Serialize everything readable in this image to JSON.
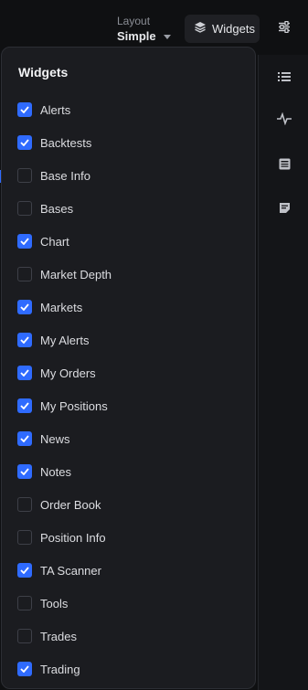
{
  "header": {
    "layout_label": "Layout",
    "layout_value": "Simple",
    "widgets_button_label": "Widgets"
  },
  "panel": {
    "title": "Widgets",
    "items": [
      {
        "label": "Alerts",
        "checked": true
      },
      {
        "label": "Backtests",
        "checked": true
      },
      {
        "label": "Base Info",
        "checked": false
      },
      {
        "label": "Bases",
        "checked": false
      },
      {
        "label": "Chart",
        "checked": true
      },
      {
        "label": "Market Depth",
        "checked": false
      },
      {
        "label": "Markets",
        "checked": true
      },
      {
        "label": "My Alerts",
        "checked": true
      },
      {
        "label": "My Orders",
        "checked": true
      },
      {
        "label": "My Positions",
        "checked": true
      },
      {
        "label": "News",
        "checked": true
      },
      {
        "label": "Notes",
        "checked": true
      },
      {
        "label": "Order Book",
        "checked": false
      },
      {
        "label": "Position Info",
        "checked": false
      },
      {
        "label": "TA Scanner",
        "checked": true
      },
      {
        "label": "Tools",
        "checked": false
      },
      {
        "label": "Trades",
        "checked": false
      },
      {
        "label": "Trading",
        "checked": true
      }
    ]
  },
  "rail_icons": [
    "list-icon",
    "activity-icon",
    "newspaper-icon",
    "note-icon"
  ],
  "colors": {
    "accent": "#2f6bff",
    "panel_bg": "#1b1c20",
    "page_bg": "#0f1012"
  }
}
